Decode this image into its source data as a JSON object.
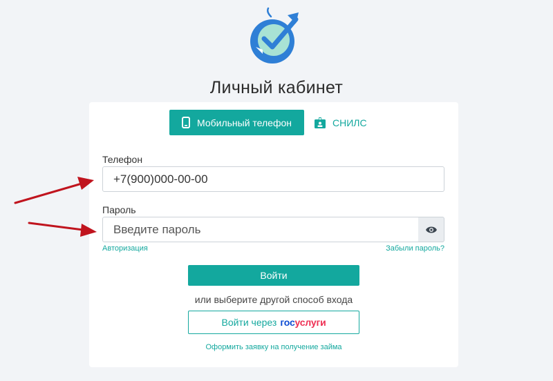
{
  "page": {
    "title": "Личный кабинет"
  },
  "tabs": {
    "phone_label": "Мобильный телефон",
    "snils_label": "СНИЛС"
  },
  "form": {
    "phone_label": "Телефон",
    "phone_value": "+7(900)000-00-00",
    "password_label": "Пароль",
    "password_placeholder": "Введите пароль",
    "auth_link": "Авторизация",
    "forgot_link": "Забыли пароль?",
    "login_button": "Войти",
    "alt_text": "или выберите другой способ входа",
    "gos_prefix": "Войти через",
    "gos_brand_part1": "гос",
    "gos_brand_part2": "услуги",
    "loan_link": "Оформить заявку на получение займа"
  },
  "colors": {
    "accent": "#13a89e",
    "arrow": "#c0141e",
    "gos_blue": "#0d4cd3",
    "gos_red": "#ee2f53",
    "logo_blue": "#2f7fd6",
    "logo_mint": "#a8e2d4"
  },
  "icons": {
    "phone_tab": "smartphone-icon",
    "snils_tab": "id-badge-icon",
    "eye": "eye-icon"
  }
}
